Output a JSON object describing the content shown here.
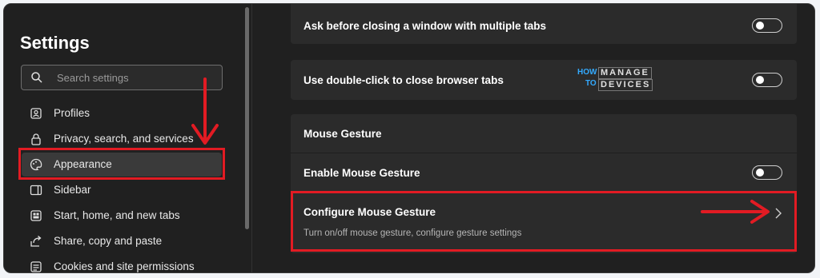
{
  "sidebar": {
    "title": "Settings",
    "search_placeholder": "Search settings",
    "items": [
      {
        "label": "Profiles",
        "icon": "profile-icon"
      },
      {
        "label": "Privacy, search, and services",
        "icon": "lock-icon"
      },
      {
        "label": "Appearance",
        "icon": "appearance-icon"
      },
      {
        "label": "Sidebar",
        "icon": "sidebar-icon"
      },
      {
        "label": "Start, home, and new tabs",
        "icon": "home-icon"
      },
      {
        "label": "Share, copy and paste",
        "icon": "share-icon"
      },
      {
        "label": "Cookies and site permissions",
        "icon": "cookies-icon"
      }
    ],
    "active_item": "Appearance"
  },
  "main": {
    "ask_before_closing": {
      "label": "Ask before closing a window with multiple tabs",
      "enabled": false
    },
    "double_click_close": {
      "label": "Use double-click to close browser tabs",
      "enabled": false
    },
    "mouse_gesture": {
      "header": "Mouse Gesture",
      "enable": {
        "label": "Enable Mouse Gesture",
        "enabled": false
      },
      "configure": {
        "label": "Configure Mouse Gesture",
        "description": "Turn on/off mouse gesture, configure gesture settings"
      }
    }
  },
  "watermark": {
    "how": "HOW",
    "to": "TO",
    "manage": "MANAGE",
    "devices": "DEVICES"
  },
  "colors": {
    "annotation": "#e21b23",
    "background": "#202020",
    "card": "#2b2b2b",
    "logo_accent": "#33aaff"
  }
}
